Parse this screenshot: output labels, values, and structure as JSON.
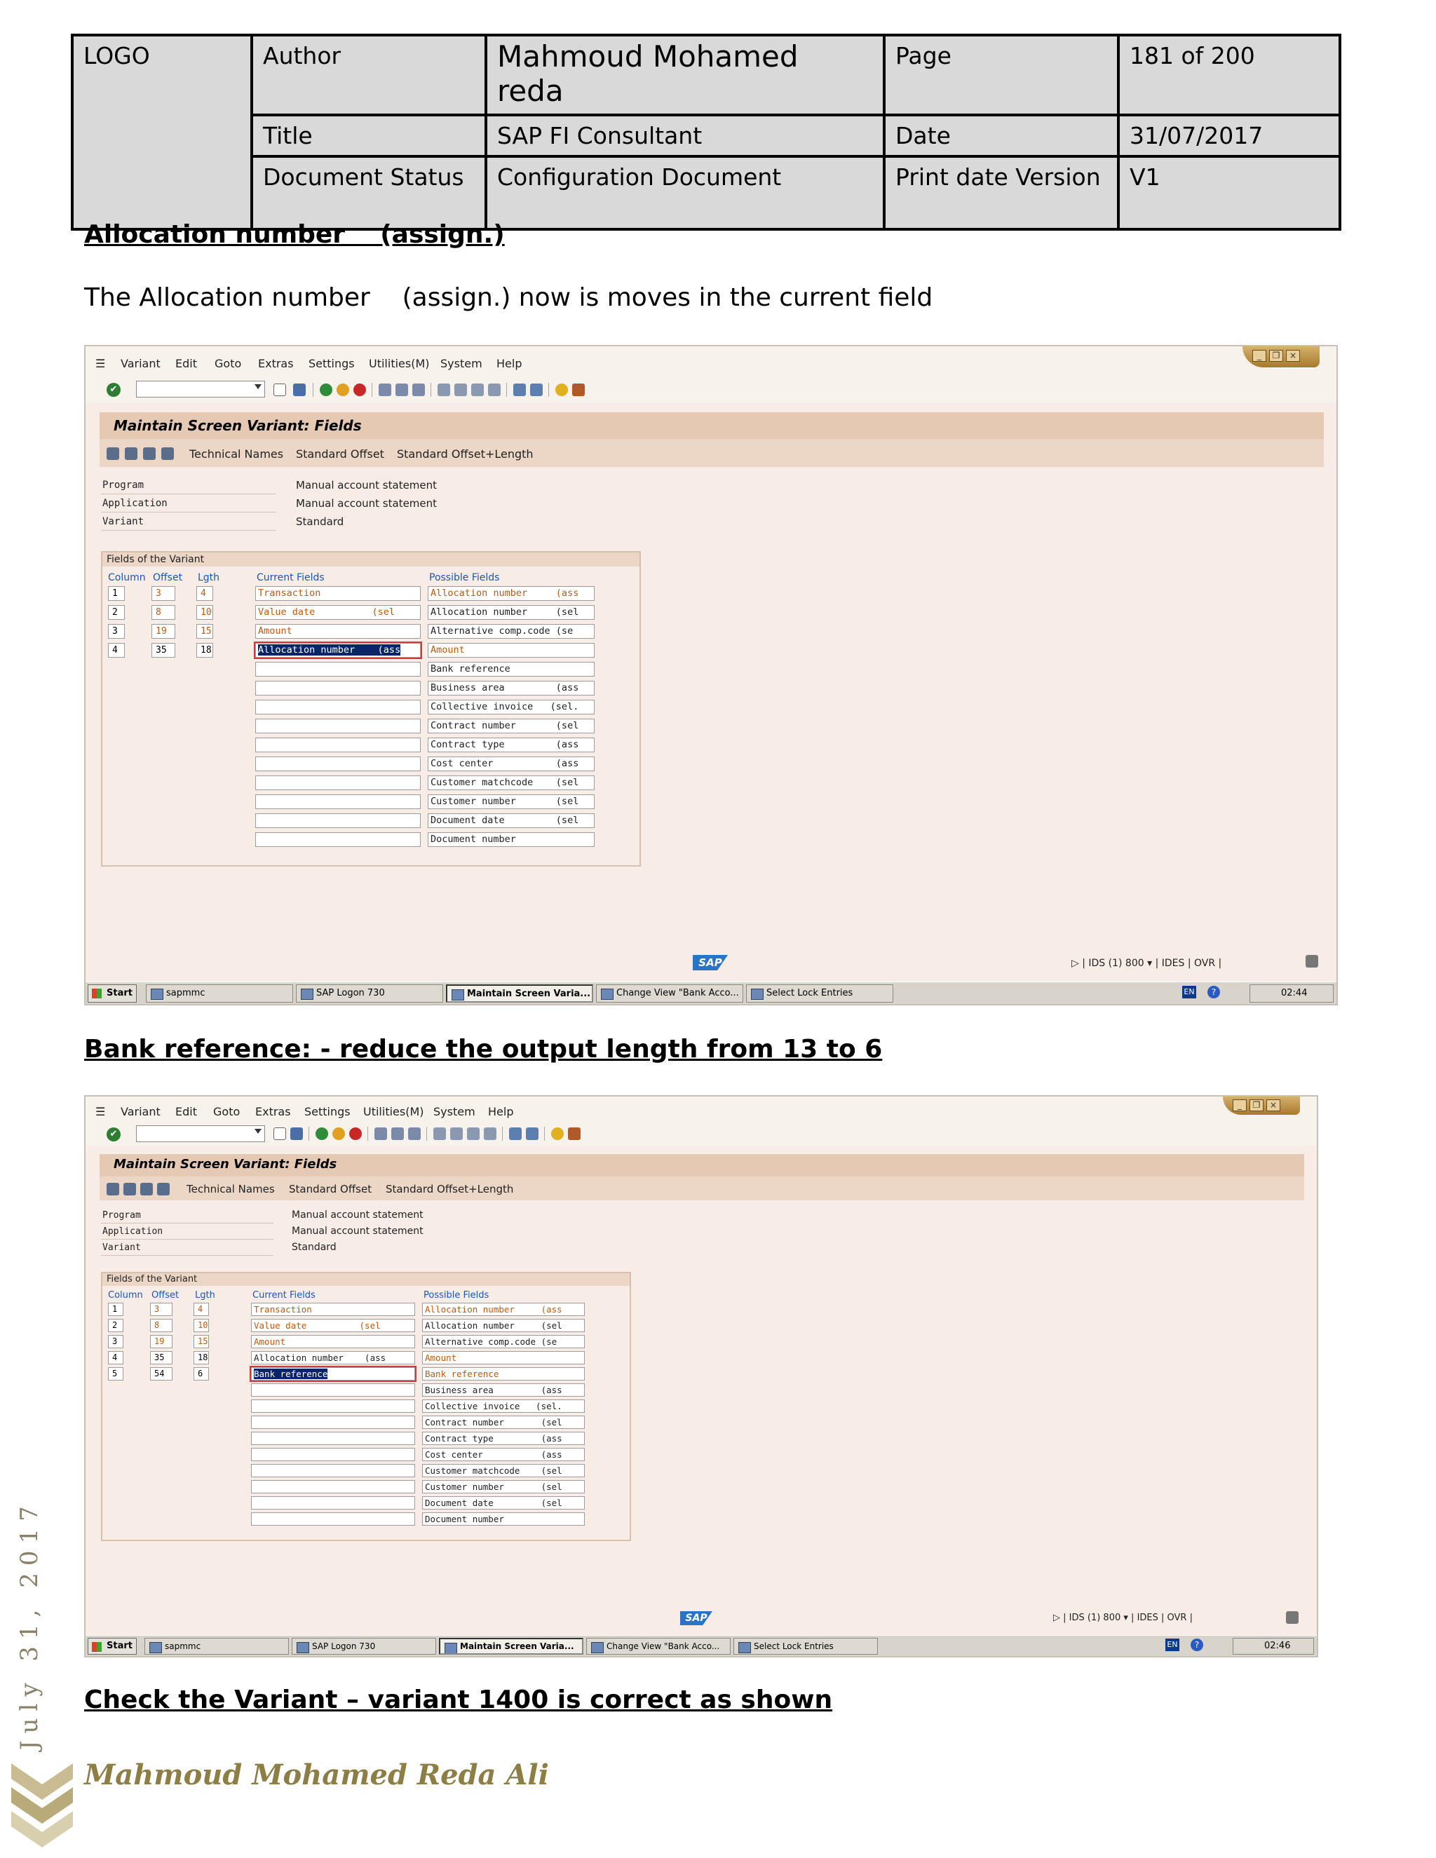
{
  "header": {
    "logo": "LOGO",
    "author_label": "Author",
    "author_value": "Mahmoud Mohamed reda",
    "page_label": "Page",
    "page_value": " 181 of 200",
    "title_label": "Title",
    "title_value": "SAP FI Consultant",
    "date_label": "Date",
    "date_value": "31/07/2017",
    "status_label": "Document Status",
    "status_value": "Configuration Document",
    "version_label": "Print date Version",
    "version_value": "V1"
  },
  "sections": {
    "s1_heading": "Allocation number    (assign.)",
    "s1_text": "The Allocation number    (assign.) now is moves in the current field",
    "s2_heading": "Bank reference: - reduce the output length from 13 to 6",
    "s3_heading": "Check the Variant – variant 1400 is correct as shown"
  },
  "sap": {
    "menu": [
      "Variant",
      "Edit",
      "Goto",
      "Extras",
      "Settings",
      "Utilities(M)",
      "System",
      "Help"
    ],
    "screen_title": "Maintain Screen Variant: Fields",
    "app_toolbar": [
      "Technical Names",
      "Standard Offset",
      "Standard Offset+Length"
    ],
    "info_labels": [
      "Program",
      "Application",
      "Variant"
    ],
    "info_values": [
      "Manual account statement",
      "Manual account statement",
      "Standard"
    ],
    "group_title": "Fields of the Variant",
    "col_headers": [
      "Column",
      "Offset",
      "Lgth",
      "Current Fields",
      "Possible Fields"
    ],
    "possible_fields": [
      "Allocation number     (ass",
      "Allocation number     (sel",
      "Alternative comp.code (se",
      "Amount",
      "Bank reference",
      "Business area         (ass",
      "Collective invoice   (sel.",
      "Contract number       (sel",
      "Contract type         (ass",
      "Cost center           (ass",
      "Customer matchcode    (sel",
      "Customer number       (sel",
      "Document date         (sel",
      "Document number"
    ],
    "status_system": "IDS (1) 800",
    "status_client": "IDES",
    "status_mode": "OVR",
    "taskbar_start": "Start",
    "taskbar_items": [
      "sapmmc",
      "SAP Logon 730",
      "Maintain Screen Varia...",
      "Change View \"Bank Acco...",
      "Select Lock Entries"
    ],
    "tray_lang": "EN",
    "logo_text": "SAP"
  },
  "screen1": {
    "rows": [
      {
        "column": "1",
        "offset": "3",
        "lgth": "4",
        "field": "Transaction"
      },
      {
        "column": "2",
        "offset": "8",
        "lgth": "10",
        "field": "Value date          (sel"
      },
      {
        "column": "3",
        "offset": "19",
        "lgth": "15",
        "field": "Amount"
      },
      {
        "column": "4",
        "offset": "35",
        "lgth": "18",
        "field": "Allocation number    (ass"
      }
    ],
    "time": "02:44"
  },
  "screen2": {
    "rows": [
      {
        "column": "1",
        "offset": "3",
        "lgth": "4",
        "field": "Transaction"
      },
      {
        "column": "2",
        "offset": "8",
        "lgth": "10",
        "field": "Value date          (sel"
      },
      {
        "column": "3",
        "offset": "19",
        "lgth": "15",
        "field": "Amount"
      },
      {
        "column": "4",
        "offset": "35",
        "lgth": "18",
        "field": "Allocation number    (ass"
      },
      {
        "column": "5",
        "offset": "54",
        "lgth": "6",
        "field": "Bank reference"
      }
    ],
    "time": "02:46"
  },
  "footer": {
    "date_vertical": "July 31, 2017",
    "signature": "Mahmoud Mohamed Reda Ali"
  }
}
